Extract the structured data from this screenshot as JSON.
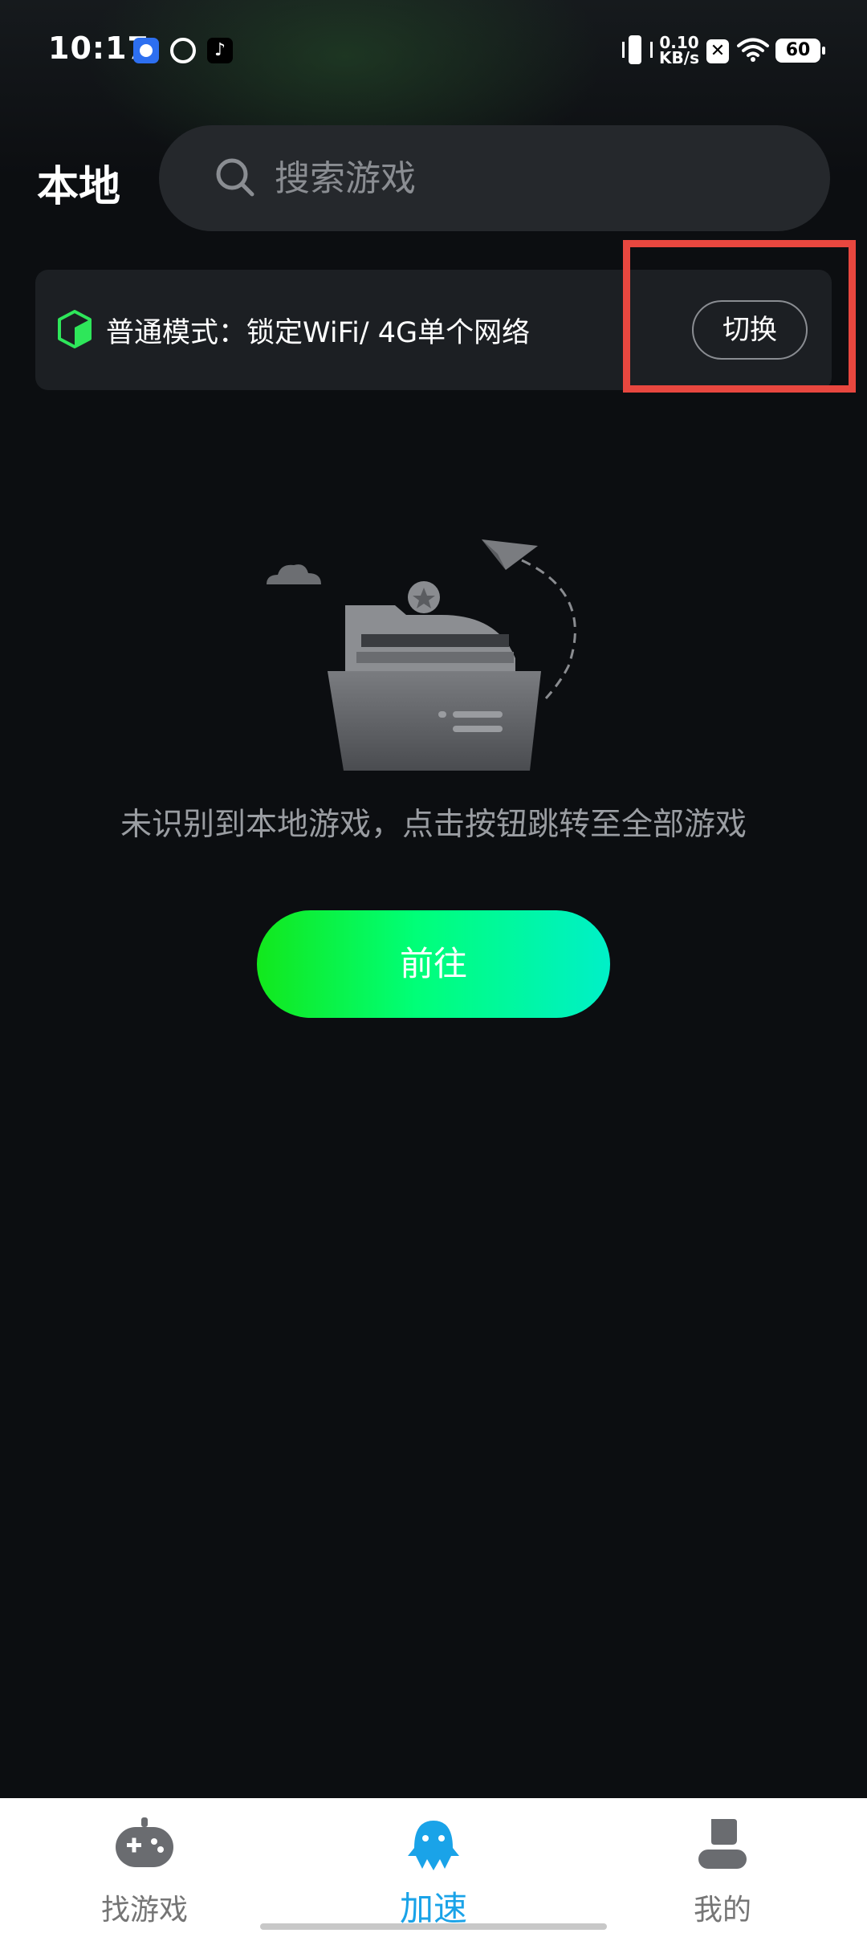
{
  "status_bar": {
    "time": "10:17",
    "net_speed_value": "0.10",
    "net_speed_unit": "KB/s",
    "battery": "60",
    "icons": [
      "app-icon-blue",
      "app-icon-ring",
      "tiktok-icon",
      "vibrate-icon",
      "x-icon",
      "wifi-icon",
      "battery-icon"
    ]
  },
  "header": {
    "title": "本地",
    "search_placeholder": "搜索游戏"
  },
  "mode_card": {
    "text": "普通模式：锁定WiFi/ 4G单个网络",
    "switch_label": "切换"
  },
  "empty_state": {
    "message": "未识别到本地游戏，点击按钮跳转至全部游戏",
    "button_label": "前往"
  },
  "bottom_nav": {
    "items": [
      {
        "label": "找游戏",
        "icon": "gamepad-icon",
        "active": false
      },
      {
        "label": "加速",
        "icon": "rocket-icon",
        "active": true
      },
      {
        "label": "我的",
        "icon": "user-icon",
        "active": false
      }
    ]
  },
  "colors": {
    "accent_green": "#12e81c",
    "accent_cyan": "#00f0c8",
    "active_tab": "#1aa3e8",
    "highlight": "#e8473f",
    "background": "#0c0e11"
  }
}
